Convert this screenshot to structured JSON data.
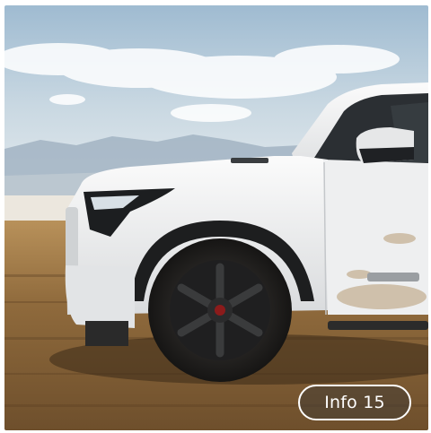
{
  "image": {
    "subject": "white-pickup-truck-photo",
    "colors": {
      "sky_top": "#a9c3d6",
      "sky_bottom": "#e8eef2",
      "ground": "#8f6a3c",
      "truck": "#f2f3f4"
    }
  },
  "info_button": {
    "label": "Info 15"
  }
}
